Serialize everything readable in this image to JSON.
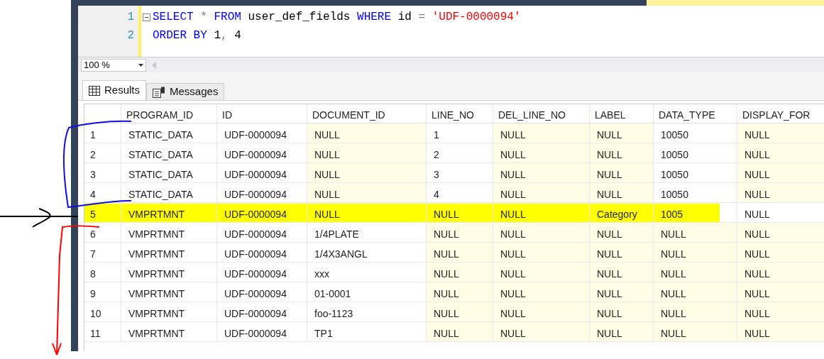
{
  "editor": {
    "lines": [
      {
        "number": "1",
        "segments": [
          {
            "kind": "keyword",
            "text": "SELECT"
          },
          {
            "kind": "operator",
            "text": " * "
          },
          {
            "kind": "keyword",
            "text": "FROM"
          },
          {
            "kind": "plain",
            "text": " user_def_fields "
          },
          {
            "kind": "keyword",
            "text": "WHERE"
          },
          {
            "kind": "plain",
            "text": " id "
          },
          {
            "kind": "operator",
            "text": "="
          },
          {
            "kind": "string",
            "text": " 'UDF-0000094'"
          }
        ]
      },
      {
        "number": "2",
        "segments": [
          {
            "kind": "keyword",
            "text": "ORDER BY"
          },
          {
            "kind": "plain",
            "text": " 1"
          },
          {
            "kind": "operator",
            "text": ","
          },
          {
            "kind": "plain",
            "text": " 4"
          }
        ]
      }
    ]
  },
  "zoom": {
    "value": "100 %"
  },
  "result_tabs": [
    {
      "label": "Results",
      "selected": true
    },
    {
      "label": "Messages",
      "selected": false
    }
  ],
  "grid": {
    "columns": [
      "PROGRAM_ID",
      "ID",
      "DOCUMENT_ID",
      "LINE_NO",
      "DEL_LINE_NO",
      "LABEL",
      "DATA_TYPE",
      "DISPLAY_FOR"
    ],
    "rows": [
      {
        "number": "1",
        "highlighted": false,
        "cells": [
          {
            "text": "STATIC_DATA",
            "null": false
          },
          {
            "text": "UDF-0000094",
            "null": false
          },
          {
            "text": "NULL",
            "null": true
          },
          {
            "text": "1",
            "null": false
          },
          {
            "text": "NULL",
            "null": true
          },
          {
            "text": "NULL",
            "null": true
          },
          {
            "text": "10050",
            "null": false
          },
          {
            "text": "NULL",
            "null": true
          }
        ]
      },
      {
        "number": "2",
        "highlighted": false,
        "cells": [
          {
            "text": "STATIC_DATA",
            "null": false
          },
          {
            "text": "UDF-0000094",
            "null": false
          },
          {
            "text": "NULL",
            "null": true
          },
          {
            "text": "2",
            "null": false
          },
          {
            "text": "NULL",
            "null": true
          },
          {
            "text": "NULL",
            "null": true
          },
          {
            "text": "10050",
            "null": false
          },
          {
            "text": "NULL",
            "null": true
          }
        ]
      },
      {
        "number": "3",
        "highlighted": false,
        "cells": [
          {
            "text": "STATIC_DATA",
            "null": false
          },
          {
            "text": "UDF-0000094",
            "null": false
          },
          {
            "text": "NULL",
            "null": true
          },
          {
            "text": "3",
            "null": false
          },
          {
            "text": "NULL",
            "null": true
          },
          {
            "text": "NULL",
            "null": true
          },
          {
            "text": "10050",
            "null": false
          },
          {
            "text": "NULL",
            "null": true
          }
        ]
      },
      {
        "number": "4",
        "highlighted": false,
        "cells": [
          {
            "text": "STATIC_DATA",
            "null": false
          },
          {
            "text": "UDF-0000094",
            "null": false
          },
          {
            "text": "NULL",
            "null": true
          },
          {
            "text": "4",
            "null": false
          },
          {
            "text": "NULL",
            "null": true
          },
          {
            "text": "NULL",
            "null": true
          },
          {
            "text": "10050",
            "null": false
          },
          {
            "text": "NULL",
            "null": true
          }
        ]
      },
      {
        "number": "5",
        "highlighted": true,
        "cells": [
          {
            "text": "VMPRTMNT"
          },
          {
            "text": "UDF-0000094"
          },
          {
            "text": "NULL"
          },
          {
            "text": "NULL"
          },
          {
            "text": "NULL"
          },
          {
            "text": "Category"
          },
          {
            "text": "1005"
          },
          {
            "text": "NULL"
          }
        ]
      },
      {
        "number": "6",
        "highlighted": false,
        "cells": [
          {
            "text": "VMPRTMNT",
            "null": false
          },
          {
            "text": "UDF-0000094",
            "null": false
          },
          {
            "text": "1/4PLATE",
            "null": false
          },
          {
            "text": "NULL",
            "null": true
          },
          {
            "text": "NULL",
            "null": true
          },
          {
            "text": "NULL",
            "null": true
          },
          {
            "text": "NULL",
            "null": true
          },
          {
            "text": "NULL",
            "null": true
          }
        ]
      },
      {
        "number": "7",
        "highlighted": false,
        "cells": [
          {
            "text": "VMPRTMNT",
            "null": false
          },
          {
            "text": "UDF-0000094",
            "null": false
          },
          {
            "text": "1/4X3ANGL",
            "null": false
          },
          {
            "text": "NULL",
            "null": true
          },
          {
            "text": "NULL",
            "null": true
          },
          {
            "text": "NULL",
            "null": true
          },
          {
            "text": "NULL",
            "null": true
          },
          {
            "text": "NULL",
            "null": true
          }
        ]
      },
      {
        "number": "8",
        "highlighted": false,
        "cells": [
          {
            "text": "VMPRTMNT",
            "null": false
          },
          {
            "text": "UDF-0000094",
            "null": false
          },
          {
            "text": "xxx",
            "null": false
          },
          {
            "text": "NULL",
            "null": true
          },
          {
            "text": "NULL",
            "null": true
          },
          {
            "text": "NULL",
            "null": true
          },
          {
            "text": "NULL",
            "null": true
          },
          {
            "text": "NULL",
            "null": true
          }
        ]
      },
      {
        "number": "9",
        "highlighted": false,
        "cells": [
          {
            "text": "VMPRTMNT",
            "null": false
          },
          {
            "text": "UDF-0000094",
            "null": false
          },
          {
            "text": "01-0001",
            "null": false
          },
          {
            "text": "NULL",
            "null": true
          },
          {
            "text": "NULL",
            "null": true
          },
          {
            "text": "NULL",
            "null": true
          },
          {
            "text": "NULL",
            "null": true
          },
          {
            "text": "NULL",
            "null": true
          }
        ]
      },
      {
        "number": "10",
        "highlighted": false,
        "cells": [
          {
            "text": "VMPRTMNT",
            "null": false
          },
          {
            "text": "UDF-0000094",
            "null": false
          },
          {
            "text": "foo-1123",
            "null": false
          },
          {
            "text": "NULL",
            "null": true
          },
          {
            "text": "NULL",
            "null": true
          },
          {
            "text": "NULL",
            "null": true
          },
          {
            "text": "NULL",
            "null": true
          },
          {
            "text": "NULL",
            "null": true
          }
        ]
      },
      {
        "number": "11",
        "highlighted": false,
        "cells": [
          {
            "text": "VMPRTMNT",
            "null": false
          },
          {
            "text": "UDF-0000094",
            "null": false
          },
          {
            "text": "TP1",
            "null": false
          },
          {
            "text": "NULL",
            "null": true
          },
          {
            "text": "NULL",
            "null": true
          },
          {
            "text": "NULL",
            "null": true
          },
          {
            "text": "NULL",
            "null": true
          },
          {
            "text": "NULL",
            "null": true
          }
        ]
      }
    ]
  }
}
